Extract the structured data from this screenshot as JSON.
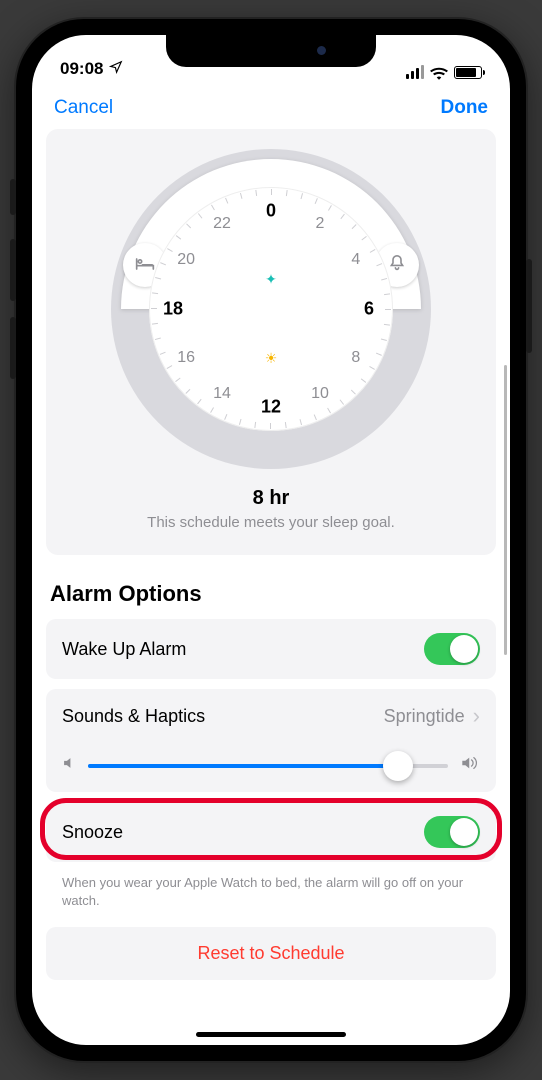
{
  "status": {
    "time": "09:08"
  },
  "nav": {
    "cancel": "Cancel",
    "done": "Done"
  },
  "dial": {
    "hours": [
      "0",
      "2",
      "4",
      "6",
      "8",
      "10",
      "12",
      "14",
      "16",
      "18",
      "20",
      "22"
    ],
    "strong_hours": [
      "0",
      "6",
      "12",
      "18"
    ],
    "duration": "8 hr",
    "goal_text": "This schedule meets your sleep goal."
  },
  "section": {
    "title": "Alarm Options"
  },
  "rows": {
    "wake": {
      "label": "Wake Up Alarm",
      "on": true
    },
    "sounds": {
      "label": "Sounds & Haptics",
      "value": "Springtide"
    },
    "volume": {
      "percent": 86
    },
    "snooze": {
      "label": "Snooze",
      "on": true
    }
  },
  "footnote": "When you wear your Apple Watch to bed, the alarm will go off on your watch.",
  "reset": {
    "label": "Reset to Schedule"
  },
  "colors": {
    "accent": "#007aff",
    "green": "#34c759",
    "red": "#ff3b30"
  }
}
